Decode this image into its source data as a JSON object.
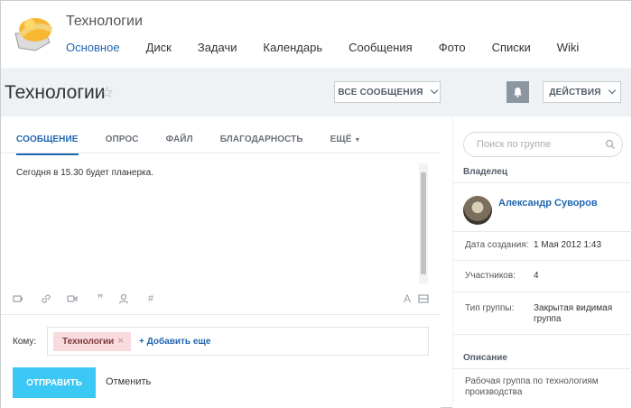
{
  "header": {
    "group_title": "Технологии",
    "nav": [
      "Основное",
      "Диск",
      "Задачи",
      "Календарь",
      "Сообщения",
      "Фото",
      "Списки",
      "Wiki"
    ]
  },
  "titlebar": {
    "title": "Технологии",
    "all_messages": "ВСЕ СООБЩЕНИЯ",
    "actions": "ДЕЙСТВИЯ"
  },
  "composer": {
    "tabs": [
      "СООБЩЕНИЕ",
      "ОПРОС",
      "ФАЙЛ",
      "БЛАГОДАРНОСТЬ",
      "ЕЩЁ"
    ],
    "text": "Сегодня в 15.30 будет планерка.",
    "to_label": "Кому:",
    "recipient": "Технологии",
    "add_more": "+ Добавить еще",
    "send": "ОТПРАВИТЬ",
    "cancel": "Отменить"
  },
  "sidebar": {
    "search_placeholder": "Поиск по группе",
    "owner_heading": "Владелец",
    "owner_name": "Александр Суворов",
    "created_label": "Дата создания:",
    "created_value": "1 Мая 2012 1:43",
    "members_label": "Участников:",
    "members_value": "4",
    "type_label": "Тип группы:",
    "type_value": "Закрытая видимая группа",
    "description_heading": "Описание",
    "description": "Рабочая группа по технологиям производства"
  },
  "colors": {
    "accent": "#2067b0",
    "send_button": "#3bc8f5",
    "chip": "#f9dbde"
  }
}
